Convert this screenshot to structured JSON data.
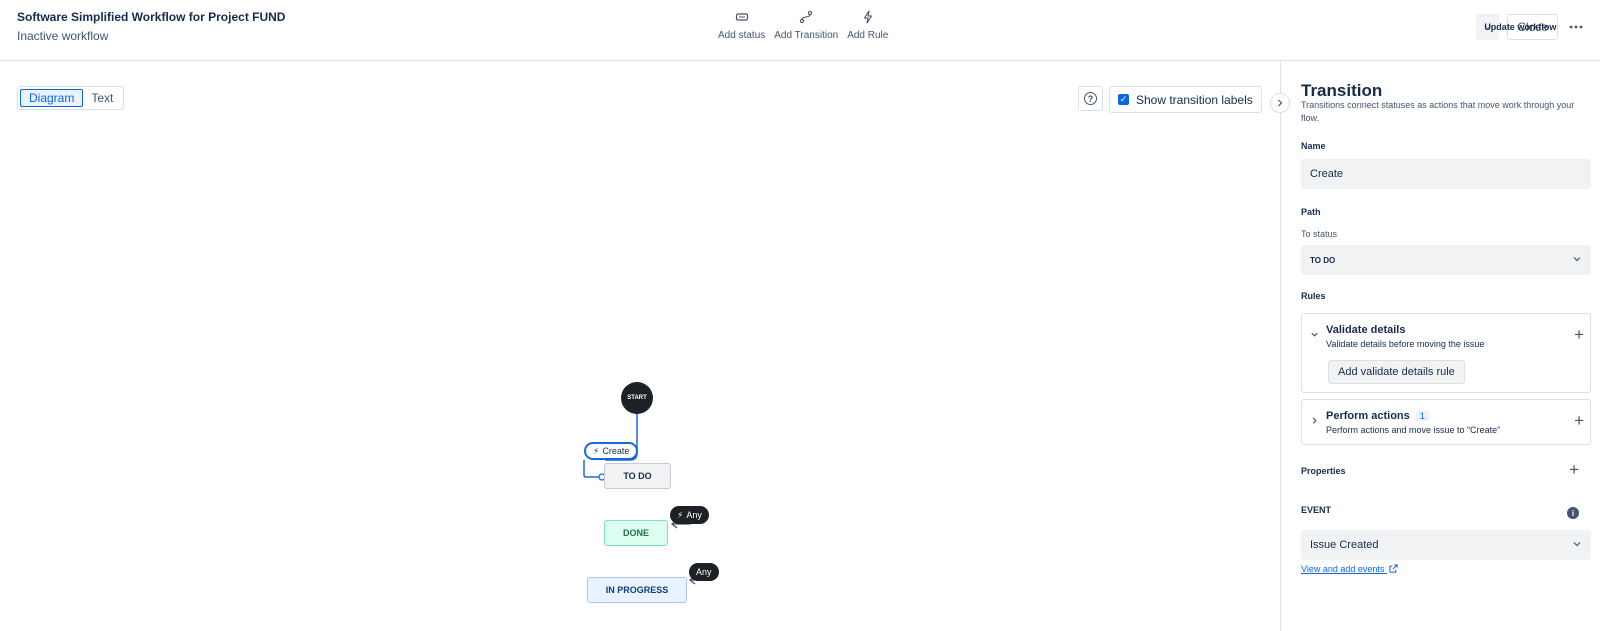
{
  "header": {
    "title": "Software Simplified Workflow for Project FUND",
    "subtitle": "Inactive workflow",
    "tools": [
      {
        "label": "Add status",
        "icon": "status-icon"
      },
      {
        "label": "Add Transition",
        "icon": "transition-icon"
      },
      {
        "label": "Add Rule",
        "icon": "rule-icon"
      }
    ],
    "update_label": "Update workflow",
    "close_label": "Close"
  },
  "canvas": {
    "view_tabs": [
      "Diagram",
      "Text"
    ],
    "active_tab": "Diagram",
    "show_labels_label": "Show transition labels",
    "show_labels_checked": true
  },
  "diagram": {
    "start": "START",
    "statuses": [
      "TO DO",
      "DONE",
      "IN PROGRESS"
    ],
    "transition_create": "Create",
    "any_label_1": "Any",
    "any_label_2": "Any",
    "colors": {
      "todo": "#f1f2f4",
      "done": "#dcfff1",
      "in_progress": "#e9f2ff",
      "selected": "#1868db"
    }
  },
  "panel": {
    "title": "Transition",
    "description": "Transitions connect statuses as actions that move work through your flow.",
    "name_label": "Name",
    "name_value": "Create",
    "path_label": "Path",
    "to_status_label": "To status",
    "to_status_value": "TO DO",
    "rules_label": "Rules",
    "validate": {
      "title": "Validate details",
      "subtitle": "Validate details before moving the issue",
      "button": "Add validate details rule"
    },
    "perform": {
      "title": "Perform actions",
      "count": "1",
      "subtitle": "Perform actions and move issue to “Create”"
    },
    "properties_label": "Properties",
    "event_label": "EVENT",
    "event_value": "Issue Created",
    "events_link": "View and add events"
  }
}
